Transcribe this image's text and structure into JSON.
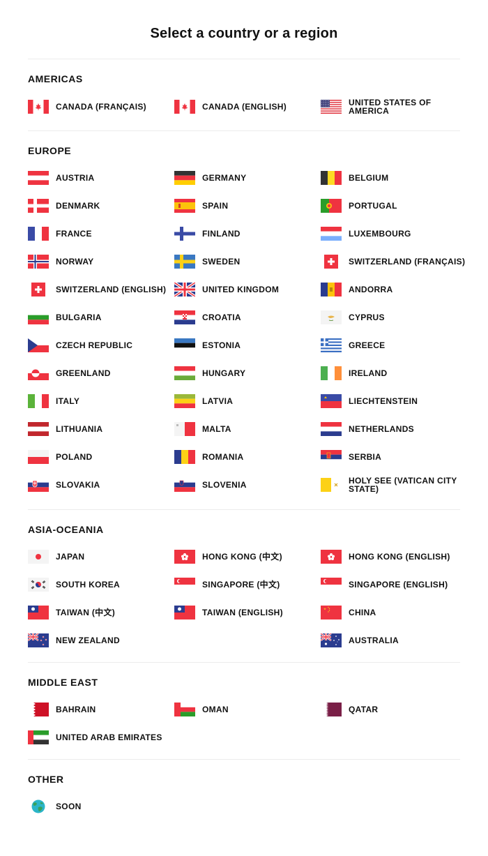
{
  "title": "Select a country or a region",
  "sections": [
    {
      "id": "americas",
      "title": "AMERICAS",
      "countries": [
        {
          "code": "ca",
          "label": "CANADA (FRANÇAIS)"
        },
        {
          "code": "ca",
          "label": "CANADA (ENGLISH)"
        },
        {
          "code": "us",
          "label": "UNITED STATES OF AMERICA"
        }
      ]
    },
    {
      "id": "europe",
      "title": "EUROPE",
      "countries": [
        {
          "code": "at",
          "label": "AUSTRIA"
        },
        {
          "code": "de",
          "label": "GERMANY"
        },
        {
          "code": "be",
          "label": "BELGIUM"
        },
        {
          "code": "dk",
          "label": "DENMARK"
        },
        {
          "code": "es",
          "label": "SPAIN"
        },
        {
          "code": "pt",
          "label": "PORTUGAL"
        },
        {
          "code": "fr",
          "label": "FRANCE"
        },
        {
          "code": "fi",
          "label": "FINLAND"
        },
        {
          "code": "lu",
          "label": "LUXEMBOURG"
        },
        {
          "code": "no",
          "label": "NORWAY"
        },
        {
          "code": "se",
          "label": "SWEDEN"
        },
        {
          "code": "ch",
          "label": "SWITZERLAND (FRANÇAIS)"
        },
        {
          "code": "ch",
          "label": "SWITZERLAND (ENGLISH)"
        },
        {
          "code": "gb",
          "label": "UNITED KINGDOM"
        },
        {
          "code": "ad",
          "label": "ANDORRA"
        },
        {
          "code": "bg",
          "label": "BULGARIA"
        },
        {
          "code": "hr",
          "label": "CROATIA"
        },
        {
          "code": "cy",
          "label": "CYPRUS"
        },
        {
          "code": "cz",
          "label": "CZECH REPUBLIC"
        },
        {
          "code": "ee",
          "label": "ESTONIA"
        },
        {
          "code": "gr",
          "label": "GREECE"
        },
        {
          "code": "gl",
          "label": "GREENLAND"
        },
        {
          "code": "hu",
          "label": "HUNGARY"
        },
        {
          "code": "ie",
          "label": "IRELAND"
        },
        {
          "code": "it",
          "label": "ITALY"
        },
        {
          "code": "lv",
          "label": "LATVIA"
        },
        {
          "code": "li",
          "label": "LIECHTENSTEIN"
        },
        {
          "code": "lt",
          "label": "LITHUANIA"
        },
        {
          "code": "mt",
          "label": "MALTA"
        },
        {
          "code": "nl",
          "label": "NETHERLANDS"
        },
        {
          "code": "pl",
          "label": "POLAND"
        },
        {
          "code": "ro",
          "label": "ROMANIA"
        },
        {
          "code": "rs",
          "label": "SERBIA"
        },
        {
          "code": "sk",
          "label": "SLOVAKIA"
        },
        {
          "code": "si",
          "label": "SLOVENIA"
        },
        {
          "code": "va",
          "label": "HOLY SEE (VATICAN CITY STATE)"
        }
      ]
    },
    {
      "id": "asia-oceania",
      "title": "ASIA-OCEANIA",
      "countries": [
        {
          "code": "jp",
          "label": "JAPAN"
        },
        {
          "code": "hk",
          "label": "HONG KONG (中文)"
        },
        {
          "code": "hk",
          "label": "HONG KONG (ENGLISH)"
        },
        {
          "code": "kr",
          "label": "SOUTH KOREA"
        },
        {
          "code": "sg",
          "label": "SINGAPORE (中文)"
        },
        {
          "code": "sg",
          "label": "SINGAPORE (ENGLISH)"
        },
        {
          "code": "tw",
          "label": "TAIWAN (中文)"
        },
        {
          "code": "tw",
          "label": "TAIWAN (ENGLISH)"
        },
        {
          "code": "cn",
          "label": "CHINA"
        },
        {
          "code": "nz",
          "label": "NEW ZEALAND"
        },
        {
          "code": "",
          "label": ""
        },
        {
          "code": "au",
          "label": "AUSTRALIA"
        }
      ]
    },
    {
      "id": "middle-east",
      "title": "MIDDLE EAST",
      "countries": [
        {
          "code": "bh",
          "label": "BAHRAIN"
        },
        {
          "code": "om",
          "label": "OMAN"
        },
        {
          "code": "qa",
          "label": "QATAR"
        },
        {
          "code": "ae",
          "label": "UNITED ARAB EMIRATES"
        }
      ]
    },
    {
      "id": "other",
      "title": "OTHER",
      "countries": [
        {
          "code": "globe",
          "label": "SOON"
        }
      ]
    }
  ]
}
